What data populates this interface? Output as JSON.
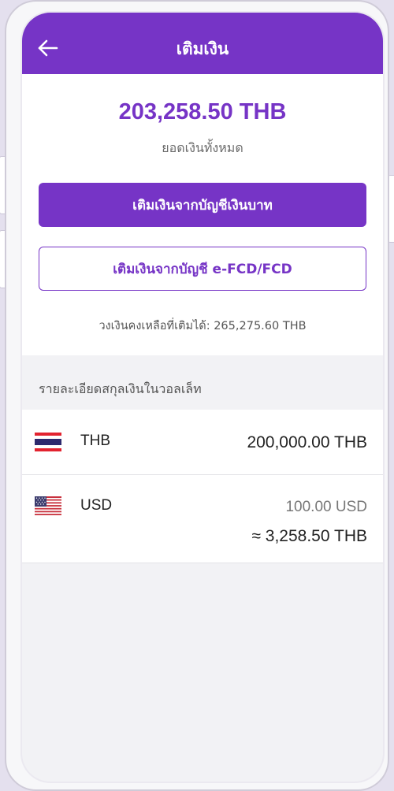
{
  "header": {
    "title": "เติมเงิน",
    "back_icon": "arrow-left-icon"
  },
  "summary": {
    "total_amount": "203,258.50 THB",
    "total_label": "ยอดเงินทั้งหมด"
  },
  "actions": {
    "primary_label": "เติมเงินจากบัญชีเงินบาท",
    "secondary_label": "เติมเงินจากบัญชี e-FCD/FCD"
  },
  "remaining_limit": "วงเงินคงเหลือที่เติมได้: 265,275.60 THB",
  "wallet": {
    "section_title": "รายละเอียดสกุลเงินในวอลเล็ท",
    "currencies": [
      {
        "flag_icon": "thailand-flag-icon",
        "code": "THB",
        "amount": "200,000.00 THB"
      },
      {
        "flag_icon": "usa-flag-icon",
        "code": "USD",
        "amount": "100.00 USD",
        "converted": "≈ 3,258.50 THB"
      }
    ]
  },
  "colors": {
    "brand": "#7634c6",
    "background": "#f2f2f5",
    "text_primary": "#222222",
    "text_secondary": "#6b6b6b"
  }
}
